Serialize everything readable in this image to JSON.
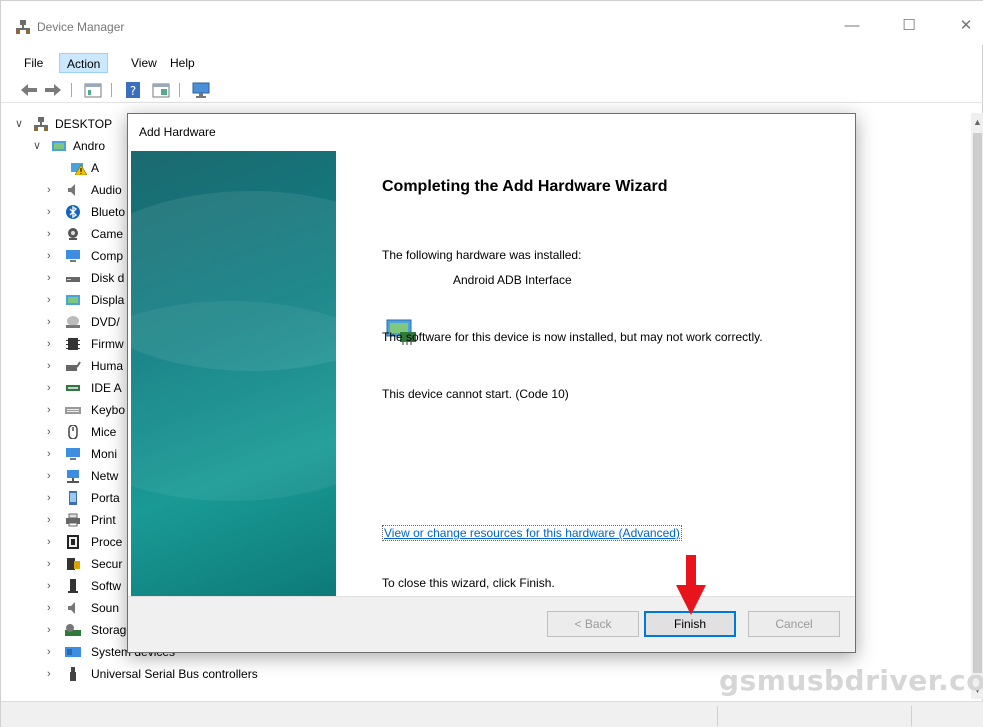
{
  "window": {
    "title": "Device Manager",
    "minimize": "—",
    "maximize": "☐",
    "close": "✕"
  },
  "menu": [
    "File",
    "Action",
    "View",
    "Help"
  ],
  "tree": {
    "root": "DESKTOP",
    "android_group": "Andro",
    "android_child": "A",
    "categories": [
      "Audio",
      "Blueto",
      "Came",
      "Comp",
      "Disk d",
      "Displa",
      "DVD/",
      "Firmw",
      "Huma",
      "IDE A",
      "Keybo",
      "Mice",
      "Moni",
      "Netw",
      "Porta",
      "Print",
      "Proce",
      "Secur",
      "Softw",
      "Soun",
      "Storage controllers",
      "System devices",
      "Universal Serial Bus controllers"
    ]
  },
  "dialog": {
    "title": "Add Hardware",
    "heading": "Completing the Add Hardware Wizard",
    "installed_intro": "The following hardware was installed:",
    "device_name": "Android ADB Interface",
    "software_note": "The software for this device is now installed, but may not work correctly.",
    "error": "This device cannot start. (Code 10)",
    "link": "View or change resources for this hardware (Advanced)",
    "close_hint": "To close this wizard, click Finish.",
    "back_label": "< Back",
    "finish_label": "Finish",
    "cancel_label": "Cancel"
  },
  "watermark": "gsmusbdriver.com",
  "colors": {
    "accent": "#0078d7",
    "arrow": "#e8141b",
    "banner": "#0e7f83"
  }
}
